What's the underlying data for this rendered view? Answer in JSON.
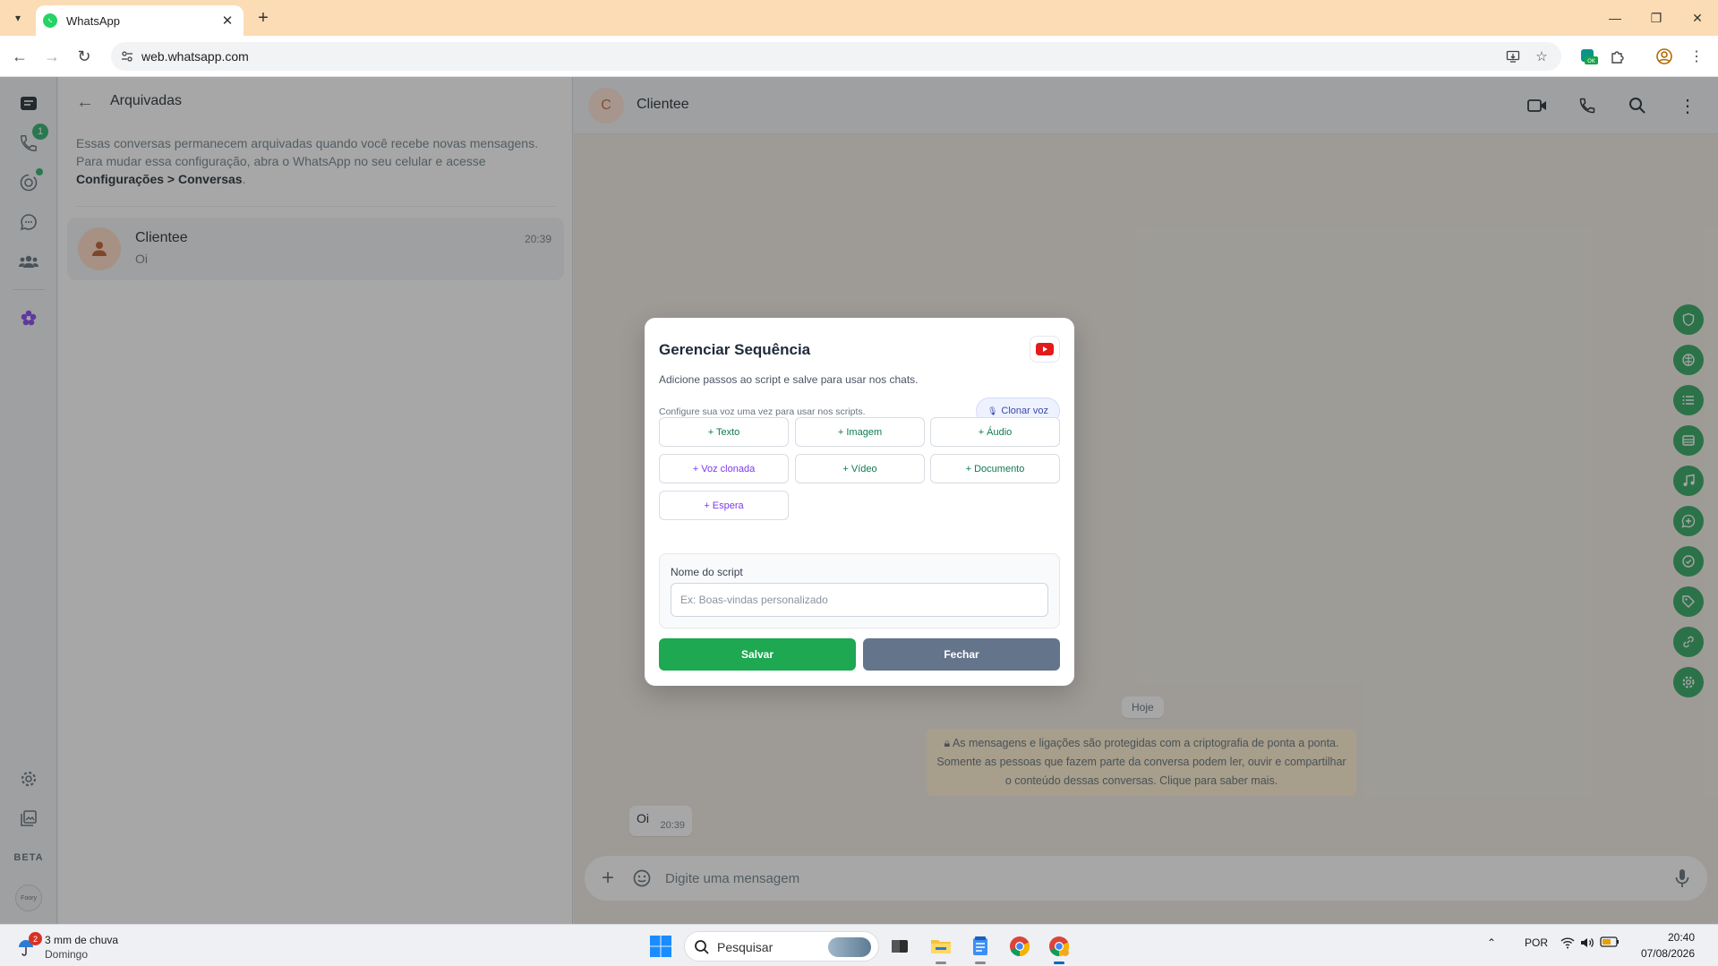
{
  "browser": {
    "tab_title": "WhatsApp",
    "url": "web.whatsapp.com",
    "extension_badge": "OK"
  },
  "nav_rail": {
    "calls_badge": "1",
    "beta_label": "BETA",
    "profile_label": "Foory"
  },
  "archived": {
    "title": "Arquivadas",
    "info_text": "Essas conversas permanecem arquivadas quando você recebe novas mensagens. Para mudar essa configuração, abra o WhatsApp no seu celular e acesse",
    "info_link": "Configurações > Conversas",
    "info_end": ".",
    "chat": {
      "name": "Clientee",
      "preview": "Oi",
      "time": "20:39"
    }
  },
  "conversation": {
    "avatar_letter": "C",
    "contact_name": "Clientee",
    "day_chip": "Hoje",
    "encryption_notice": "As mensagens e ligações são protegidas com a criptografia de ponta a ponta. Somente as pessoas que fazem parte da conversa podem ler, ouvir e compartilhar o conteúdo dessas conversas. Clique para saber mais.",
    "message": {
      "text": "Oi",
      "time": "20:39"
    },
    "composer_placeholder": "Digite uma mensagem"
  },
  "modal": {
    "title": "Gerenciar Sequência",
    "subtitle": "Adicione passos ao script e salve para usar nos chats.",
    "voice_hint": "Configure sua voz uma vez para usar nos scripts.",
    "clone_voice_label": "Clonar voz",
    "steps": {
      "text": "+ Texto",
      "image": "+ Imagem",
      "audio": "+ Áudio",
      "cloned_voice": "+ Voz clonada",
      "video": "+ Vídeo",
      "document": "+ Documento",
      "wait": "+ Espera"
    },
    "script_label": "Nome do script",
    "script_placeholder": "Ex: Boas-vindas personalizado",
    "save_label": "Salvar",
    "close_label": "Fechar"
  },
  "taskbar": {
    "weather_badge": "2",
    "weather_line1": "3 mm de chuva",
    "weather_line2": "Domingo",
    "search_placeholder": "Pesquisar",
    "language": "POR",
    "time": "20:40",
    "date": "07/08/2026"
  },
  "colors": {
    "accent_green": "#1da851",
    "side_action_green": "#1f9e53",
    "browser_tab_bar": "#fcdcb4",
    "close_button": "#64748b"
  }
}
